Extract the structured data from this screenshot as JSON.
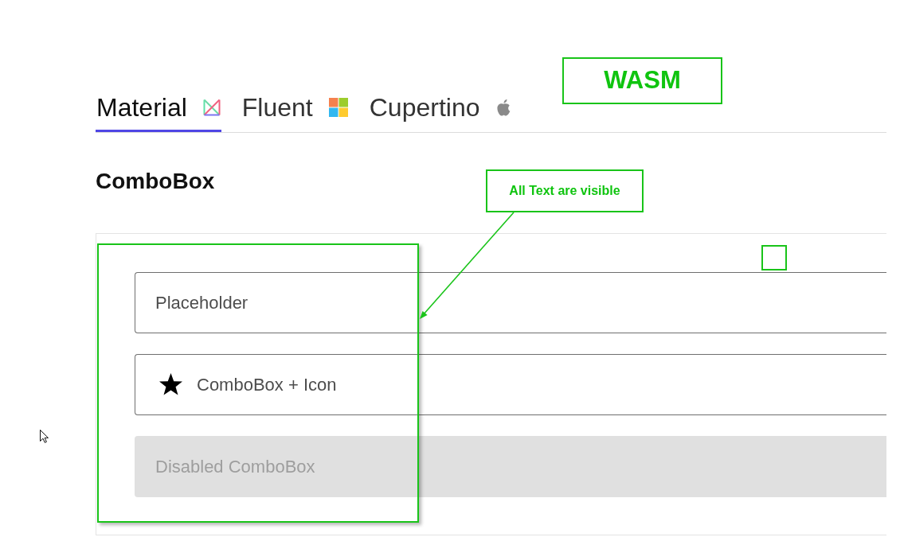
{
  "tabs": [
    {
      "label": "Material",
      "selected": true
    },
    {
      "label": "Fluent",
      "selected": false
    },
    {
      "label": "Cupertino",
      "selected": false
    }
  ],
  "heading": "ComboBox",
  "comboboxes": [
    {
      "kind": "plain",
      "placeholder": "Placeholder",
      "disabled": false
    },
    {
      "kind": "with-icon",
      "placeholder": "ComboBox + Icon",
      "disabled": false
    },
    {
      "kind": "plain",
      "placeholder": "Disabled ComboBox",
      "disabled": true
    }
  ],
  "annotations": {
    "label": "WASM",
    "callout": "All Text are visible"
  }
}
